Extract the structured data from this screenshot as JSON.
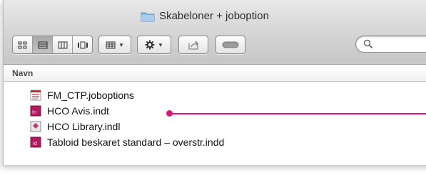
{
  "window": {
    "title": "Skabeloner + joboption"
  },
  "toolbar": {
    "view_buttons": [
      "icon-view",
      "list-view",
      "column-view",
      "coverflow-view"
    ],
    "active_view": "list-view",
    "arrange_icon": "arrange-grid-icon",
    "action_icon": "gear-icon",
    "share_icon": "share-icon",
    "tags_icon": "toggle-pill-icon",
    "search_icon": "magnifier-icon"
  },
  "list": {
    "column_header": "Navn",
    "files": [
      {
        "name": "FM_CTP.joboptions",
        "icon": "joboptions-file-icon"
      },
      {
        "name": "HCO Avis.indt",
        "icon": "indesign-template-icon"
      },
      {
        "name": "HCO Library.indl",
        "icon": "indesign-library-icon"
      },
      {
        "name": "Tabloid beskaret standard – overstr.indd",
        "icon": "indesign-document-icon"
      }
    ]
  },
  "annotation": {
    "pointer_color": "#e0147d"
  },
  "colors": {
    "indesign": "#b3185f",
    "pdf_red": "#cc2a2a",
    "accent_pink": "#e0147d"
  }
}
